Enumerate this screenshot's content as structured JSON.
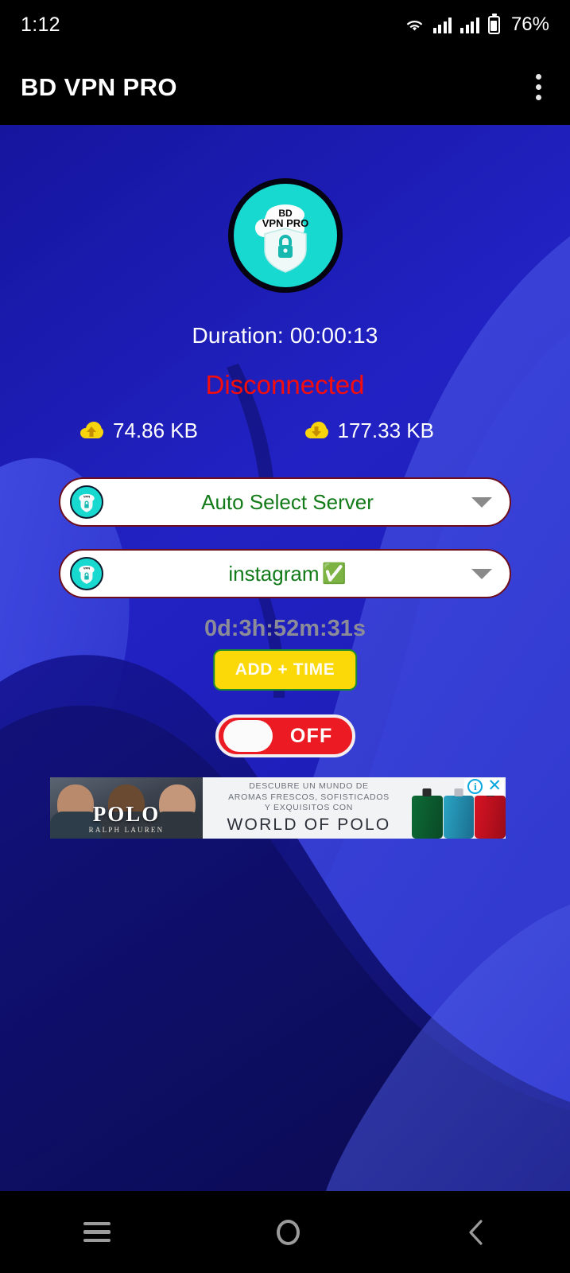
{
  "status_bar": {
    "time": "1:12",
    "battery_percent": "76%",
    "icons": [
      "wifi-icon",
      "signal-icon-1",
      "signal-icon-2",
      "battery-icon"
    ]
  },
  "app_bar": {
    "title": "BD VPN PRO",
    "overflow_menu": "more-options"
  },
  "logo": {
    "brand_line1": "BD",
    "brand_line2": "VPN PRO",
    "circle_color": "#17d9d0",
    "border_color": "#05030f"
  },
  "main": {
    "duration_label": "Duration: 00:00:13",
    "connection_status": "Disconnected",
    "status_color": "#f50d0d",
    "upload": {
      "value": "74.86 KB",
      "icon": "cloud-upload-icon",
      "icon_color": "#f7d40b"
    },
    "download": {
      "value": "177.33 KB",
      "icon": "cloud-download-icon",
      "icon_color": "#f7d40b"
    },
    "server_dropdown": {
      "value": "Auto Select Server",
      "text_color": "#127a18",
      "border_color": "#6d0e1c"
    },
    "app_dropdown": {
      "value": "instagram",
      "badge": "✅",
      "text_color": "#127a18",
      "border_color": "#6d0e1c"
    },
    "countdown": "0d:3h:52m:31s",
    "add_time_button": "ADD + TIME",
    "add_time_bg": "#fbd808",
    "toggle": {
      "label": "OFF",
      "state": "off",
      "color": "#ec1b23"
    }
  },
  "ad": {
    "brand": "POLO",
    "brand_sub": "RALPH LAUREN",
    "line1": "DESCUBRE UN MUNDO DE",
    "line2": "AROMAS FRESCOS, SOFISTICADOS",
    "line3": "Y EXQUISITOS CON",
    "headline": "WORLD OF POLO",
    "info_glyph": "i",
    "close_glyph": "✕"
  },
  "nav_bar": {
    "recents": "recents-button",
    "home": "home-button",
    "back": "back-button"
  }
}
